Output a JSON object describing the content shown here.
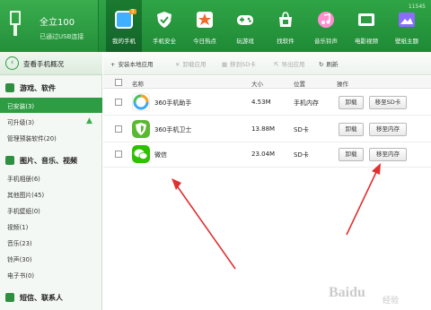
{
  "device": {
    "name": "全立100",
    "status": "已通过USB连接"
  },
  "clock": "11545",
  "nav": {
    "items": [
      {
        "label": "我的手机",
        "badge": "3",
        "icon": "phone-icon",
        "color": "#3fb0ff"
      },
      {
        "label": "手机安全",
        "icon": "shield-icon",
        "color": "#ffffff"
      },
      {
        "label": "今日热点",
        "icon": "star-icon",
        "color": "#ffffff"
      },
      {
        "label": "玩游戏",
        "icon": "gamepad-icon",
        "color": "#ffffff"
      },
      {
        "label": "找软件",
        "icon": "store-icon",
        "color": "#ffffff"
      },
      {
        "label": "音乐铃声",
        "icon": "music-icon",
        "color": "#ff8fd0"
      },
      {
        "label": "电影视频",
        "icon": "film-icon",
        "color": "#ffffff"
      },
      {
        "label": "壁纸主题",
        "icon": "picture-icon",
        "color": "#8a6cff"
      },
      {
        "label": "",
        "icon": "more-icon",
        "color": "#ffffff"
      }
    ]
  },
  "sidebar": {
    "overview": "查看手机概况",
    "sections": [
      {
        "title": "游戏、软件",
        "items": [
          "已安装(3)",
          "可升级(3)",
          "管理预装软件(20)"
        ]
      },
      {
        "title": "图片、音乐、视频",
        "items": [
          "手机相册(6)",
          "其他图片(45)",
          "手机壁纸(0)",
          "视频(1)",
          "音乐(23)",
          "铃声(30)",
          "电子书(0)"
        ]
      },
      {
        "title": "短信、联系人",
        "items": []
      }
    ]
  },
  "toolbar": {
    "install": "安装本地应用",
    "uninstall": "卸载应用",
    "move_sd": "移到SD卡",
    "export": "导出应用",
    "refresh": "刷新"
  },
  "table": {
    "headers": {
      "name": "名称",
      "size": "大小",
      "location": "位置",
      "action": "操作"
    },
    "rows": [
      {
        "name": "360手机助手",
        "size": "4.53M",
        "location": "手机内存",
        "btn1": "卸载",
        "btn2": "移至SD卡",
        "icon": "assistant-icon"
      },
      {
        "name": "360手机卫士",
        "size": "13.88M",
        "location": "SD卡",
        "btn1": "卸载",
        "btn2": "移至内存",
        "icon": "guard-icon"
      },
      {
        "name": "微信",
        "size": "23.04M",
        "location": "SD卡",
        "btn1": "卸载",
        "btn2": "移至内存",
        "icon": "wechat-icon"
      }
    ]
  },
  "colors": {
    "brand_green": "#2e9c42",
    "arrow_red": "#e03030"
  },
  "watermark": {
    "brand": "Baidu",
    "sub": "经验"
  }
}
